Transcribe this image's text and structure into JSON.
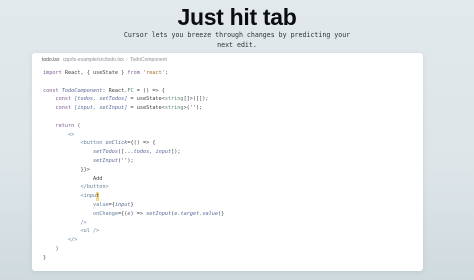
{
  "hero": {
    "title": "Just hit tab",
    "subtitle": "Cursor lets you breeze through changes by predicting your next edit."
  },
  "editor": {
    "breadcrumb": {
      "file": "todo.tsx",
      "path": "cpp/tx-example/src/todo.tsx",
      "symbol": "TodoComponent"
    },
    "code_lines": [
      [
        {
          "t": "import ",
          "c": "kw"
        },
        {
          "t": "React, { useState } ",
          "c": "pl"
        },
        {
          "t": "from ",
          "c": "kw"
        },
        {
          "t": "'react'",
          "c": "st"
        },
        {
          "t": ";",
          "c": "pl"
        }
      ],
      [],
      [
        {
          "t": "const ",
          "c": "kw"
        },
        {
          "t": "TodoComponent",
          "c": "fn"
        },
        {
          "t": ": React.",
          "c": "pl"
        },
        {
          "t": "FC",
          "c": "ty"
        },
        {
          "t": " = () => {",
          "c": "pl"
        }
      ],
      [
        {
          "t": "    const ",
          "c": "kw"
        },
        {
          "t": "[todos, setTodos]",
          "c": "fn"
        },
        {
          "t": " = useState<",
          "c": "pl"
        },
        {
          "t": "string",
          "c": "ty"
        },
        {
          "t": "[]>([]);",
          "c": "pl"
        }
      ],
      [
        {
          "t": "    const ",
          "c": "kw"
        },
        {
          "t": "[input, setInput]",
          "c": "fn"
        },
        {
          "t": " = useState<",
          "c": "pl"
        },
        {
          "t": "string",
          "c": "ty"
        },
        {
          "t": ">('');",
          "c": "pl"
        }
      ],
      [],
      [
        {
          "t": "    return ",
          "c": "kw"
        },
        {
          "t": "(",
          "c": "pl"
        }
      ],
      [
        {
          "t": "        <>",
          "c": "tg"
        }
      ],
      [
        {
          "t": "            <",
          "c": "tg"
        },
        {
          "t": "button ",
          "c": "tg"
        },
        {
          "t": "onClick",
          "c": "fn"
        },
        {
          "t": "={() => {",
          "c": "pl"
        }
      ],
      [
        {
          "t": "                setTodos",
          "c": "fn"
        },
        {
          "t": "([...",
          "c": "pl"
        },
        {
          "t": "todos, input",
          "c": "fn"
        },
        {
          "t": "]);",
          "c": "pl"
        }
      ],
      [
        {
          "t": "                setInput",
          "c": "fn"
        },
        {
          "t": "('');",
          "c": "pl"
        }
      ],
      [
        {
          "t": "            }}>",
          "c": "pl"
        }
      ],
      [
        {
          "t": "                Add",
          "c": "pl"
        }
      ],
      [
        {
          "t": "            </",
          "c": "tg"
        },
        {
          "t": "button",
          "c": "tg"
        },
        {
          "t": ">",
          "c": "tg"
        }
      ],
      [
        {
          "t": "            <",
          "c": "tg"
        },
        {
          "t": "inpu",
          "c": "tg"
        },
        {
          "t": "t",
          "c": "cur"
        }
      ],
      [
        {
          "t": "                value",
          "c": "tg"
        },
        {
          "t": "={",
          "c": "pl"
        },
        {
          "t": "input",
          "c": "fn"
        },
        {
          "t": "}",
          "c": "pl"
        }
      ],
      [
        {
          "t": "                onChange",
          "c": "tg"
        },
        {
          "t": "={(",
          "c": "pl"
        },
        {
          "t": "e",
          "c": "fn"
        },
        {
          "t": ") => ",
          "c": "pl"
        },
        {
          "t": "setInput",
          "c": "fn"
        },
        {
          "t": "(",
          "c": "pl"
        },
        {
          "t": "e.target.value",
          "c": "fn"
        },
        {
          "t": ")}",
          "c": "pl"
        }
      ],
      [
        {
          "t": "            />",
          "c": "tg"
        }
      ],
      [
        {
          "t": "            <",
          "c": "tg"
        },
        {
          "t": "ul ",
          "c": "tg"
        },
        {
          "t": "/>",
          "c": "tg"
        }
      ],
      [
        {
          "t": "        </>",
          "c": "tg"
        }
      ],
      [
        {
          "t": "    )",
          "c": "pl"
        }
      ],
      [
        {
          "t": "}",
          "c": "pl"
        }
      ]
    ]
  }
}
